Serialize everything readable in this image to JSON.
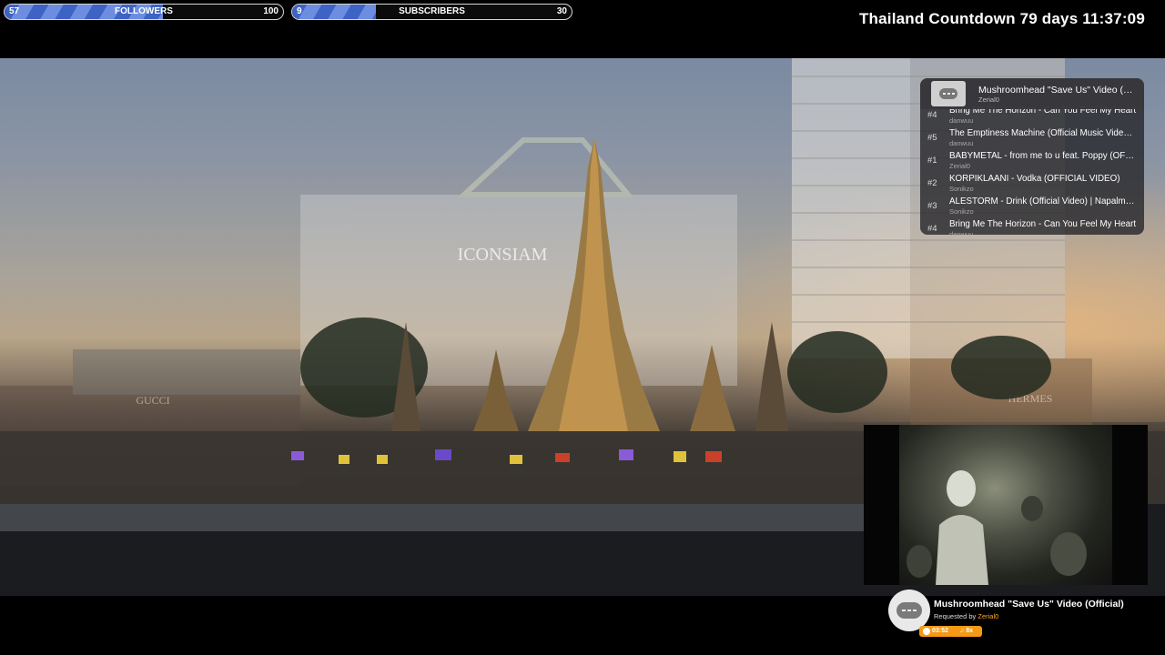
{
  "goals": {
    "followers": {
      "current": "57",
      "name": "FOLLOWERS",
      "target": "100",
      "progress": 0.57
    },
    "subscribers": {
      "current": "9",
      "name": "SUBSCRIBERS",
      "target": "30",
      "progress": 0.3
    }
  },
  "countdown": {
    "text": "Thailand Countdown 79 days 11:37:09"
  },
  "scene": {
    "sign_text": "ICONSIAM",
    "sign2_text": "HERMES",
    "sign3_text": "GUCCI"
  },
  "queue": {
    "now_playing": {
      "title": "Mushroomhead \"Save Us\" Video (Official)",
      "user": "Zerial0"
    },
    "items": [
      {
        "rank": "#4",
        "title": "Bring Me The Horizon - Can You Feel My Heart",
        "user": "danwuu"
      },
      {
        "rank": "#5",
        "title": "The Emptiness Machine (Official Music Video) - Linkin Park",
        "user": "danwuu"
      },
      {
        "rank": "#1",
        "title": "BABYMETAL - from me to u feat. Poppy (OFFICIAL)",
        "user": "Zerial0"
      },
      {
        "rank": "#2",
        "title": "KORPIKLAANI - Vodka (OFFICIAL VIDEO)",
        "user": "Sonikzo"
      },
      {
        "rank": "#3",
        "title": "ALESTORM - Drink (Official Video) | Napalm Records",
        "user": "Sonikzo"
      },
      {
        "rank": "#4",
        "title": "Bring Me The Horizon - Can You Feel My Heart",
        "user": "danwuu"
      }
    ]
  },
  "now_playing": {
    "title": "Mushroomhead \"Save Us\" Video (Official)",
    "requested_label": "Requested by ",
    "requested_by": "Zerial0",
    "duration": "03:52",
    "count": "8x"
  },
  "colors": {
    "accent_orange": "#f59a16",
    "goal_fill": "#3d63c4"
  },
  "icons": {
    "queue_thumb": "chat-bubble-icon",
    "now_playing": "chat-bubble-icon",
    "badge": "music-note-icon"
  }
}
